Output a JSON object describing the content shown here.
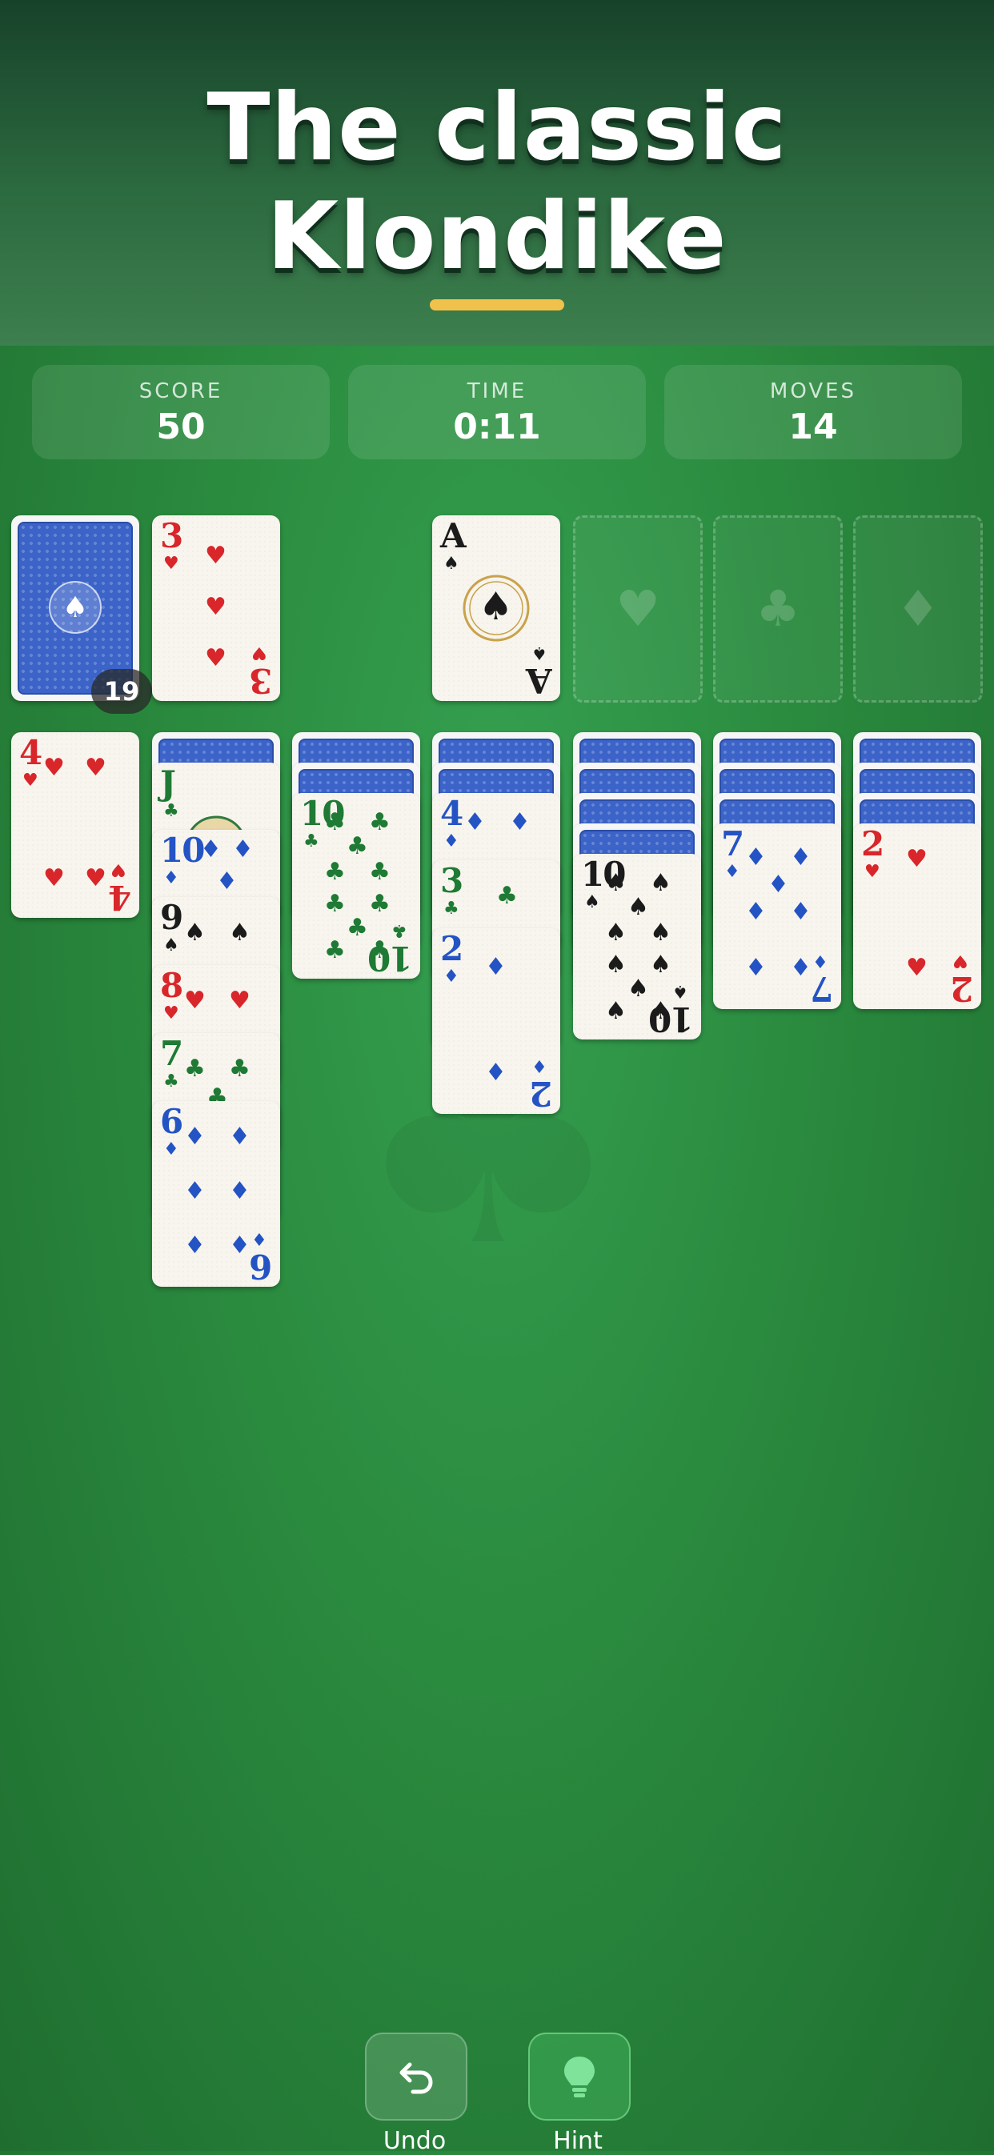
{
  "hero": {
    "line1": "The classic",
    "line2": "Klondike"
  },
  "stats": [
    {
      "label": "SCORE",
      "value": "50"
    },
    {
      "label": "TIME",
      "value": "0:11"
    },
    {
      "label": "MOVES",
      "value": "14"
    }
  ],
  "stock": {
    "remaining": "19"
  },
  "waste": {
    "rank": "3",
    "suit": "♥"
  },
  "foundations": [
    {
      "rank": "A",
      "suit": "♠"
    },
    {
      "placeholder": "♥"
    },
    {
      "placeholder": "♣"
    },
    {
      "placeholder": "♦"
    }
  ],
  "tableau": {
    "col1": [
      {
        "rank": "4",
        "suit": "♥"
      }
    ],
    "col2": [
      {
        "rank": "J",
        "suit": "♣"
      },
      {
        "rank": "10",
        "suit": "♦"
      },
      {
        "rank": "9",
        "suit": "♠"
      },
      {
        "rank": "8",
        "suit": "♥"
      },
      {
        "rank": "7",
        "suit": "♣"
      },
      {
        "rank": "6",
        "suit": "♦"
      }
    ],
    "col3": [
      {
        "rank": "10",
        "suit": "♣"
      }
    ],
    "col4": [
      {
        "rank": "4",
        "suit": "♦"
      },
      {
        "rank": "3",
        "suit": "♣"
      },
      {
        "rank": "2",
        "suit": "♦"
      }
    ],
    "col5": [
      {
        "rank": "10",
        "suit": "♠"
      }
    ],
    "col6": [
      {
        "rank": "7",
        "suit": "♦"
      }
    ],
    "col7": [
      {
        "rank": "2",
        "suit": "♥"
      }
    ]
  },
  "toolbar": {
    "undo_label": "Undo",
    "hint_label": "Hint"
  },
  "colors": {
    "accent": "#f0c24b",
    "table_green": "#2a8a3e",
    "heart": "#d8262b",
    "diamond": "#2453c4",
    "club": "#1e7a34",
    "spade": "#1b1b1b",
    "card_back": "#3b63c8"
  }
}
